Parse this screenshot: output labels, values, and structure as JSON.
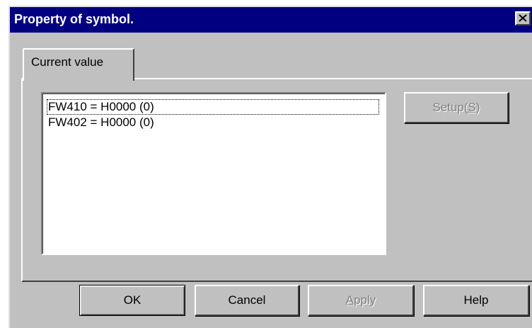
{
  "window": {
    "title": "Property of symbol."
  },
  "tabs": [
    {
      "label": "Current value"
    }
  ],
  "list": {
    "items": [
      {
        "text": "FW410 = H0000 (0)"
      },
      {
        "text": "FW402 = H0000 (0)"
      }
    ]
  },
  "setup_button": {
    "label_prefix": "Setup(",
    "mnemonic": "S",
    "label_suffix": ")"
  },
  "buttons": {
    "ok": "OK",
    "cancel": "Cancel",
    "apply_mnemonic": "A",
    "apply_rest": "pply",
    "help": "Help"
  },
  "colors": {
    "titlebar": "#000080",
    "face": "#c0c0c0"
  },
  "icons": {
    "close": "close-icon"
  }
}
